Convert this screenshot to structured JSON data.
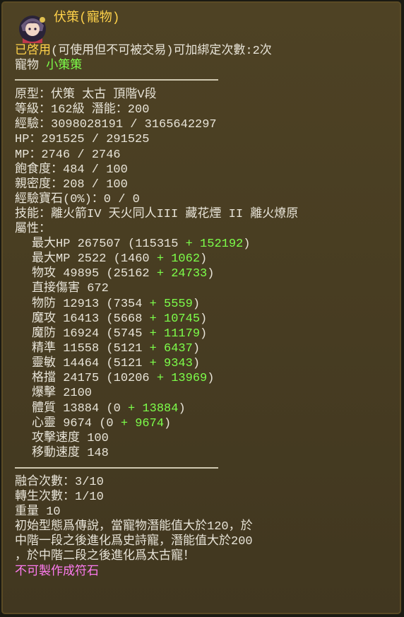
{
  "header": {
    "title": "伏策(寵物)"
  },
  "status": {
    "enabled": "已啓用",
    "rest": "(可使用但不可被交易)可加綁定次數:2次"
  },
  "pet": {
    "label": "寵物 ",
    "name": "小策策"
  },
  "info": {
    "prototype": "原型：伏策 太古 頂階V段",
    "level": "等級：162級 潛能：200",
    "exp": "經驗：3098028191 / 3165642297",
    "hp": "HP：291525 / 291525",
    "mp": "MP：2746 / 2746",
    "satiety": "飽食度：484 / 100",
    "intimacy": "親密度：208 / 100",
    "exp_gem": "經驗寶石(0%)：0 / 0",
    "skills": "技能：離火箭IV 天火同人III 藏花煙 II 離火燎原",
    "attr_title": "屬性："
  },
  "attributes": [
    {
      "base": "最大HP 267507 (115315 ",
      "plus": "+ ",
      "bonus": "152192",
      "close": ")"
    },
    {
      "base": "最大MP 2522 (1460 ",
      "plus": "+ ",
      "bonus": "1062",
      "close": ")"
    },
    {
      "base": "物攻 49895 (25162 ",
      "plus": "+ ",
      "bonus": "24733",
      "close": ")"
    },
    {
      "base": "直接傷害 672",
      "plus": "",
      "bonus": "",
      "close": ""
    },
    {
      "base": "物防 12913 (7354 ",
      "plus": "+ ",
      "bonus": "5559",
      "close": ")"
    },
    {
      "base": "魔攻 16413 (5668 ",
      "plus": "+ ",
      "bonus": "10745",
      "close": ")"
    },
    {
      "base": "魔防 16924 (5745 ",
      "plus": "+ ",
      "bonus": "11179",
      "close": ")"
    },
    {
      "base": "精準 11558 (5121 ",
      "plus": "+ ",
      "bonus": "6437",
      "close": ")"
    },
    {
      "base": "靈敏 14464 (5121 ",
      "plus": "+ ",
      "bonus": "9343",
      "close": ")"
    },
    {
      "base": "格擋 24175 (10206 ",
      "plus": "+ ",
      "bonus": "13969",
      "close": ")"
    },
    {
      "base": "爆擊 2100",
      "plus": "",
      "bonus": "",
      "close": ""
    },
    {
      "base": "體質 13884 (0 ",
      "plus": "+ ",
      "bonus": "13884",
      "close": ")"
    },
    {
      "base": "心靈 9674 (0 ",
      "plus": "+ ",
      "bonus": "9674",
      "close": ")"
    },
    {
      "base": "攻擊速度 100",
      "plus": "",
      "bonus": "",
      "close": ""
    },
    {
      "base": "移動速度 148",
      "plus": "",
      "bonus": "",
      "close": ""
    }
  ],
  "footer": {
    "fusion": "融合次數：3/10",
    "rebirth": "轉生次數：1/10",
    "weight": "重量 10",
    "desc1": "初始型態爲傳說，當寵物潛能值大於120，於",
    "desc2": "中階一段之後進化爲史詩寵，潛能值大於200",
    "desc3": "，於中階二段之後進化爲太古寵！",
    "note": "不可製作成符石"
  },
  "colors": {
    "gold": "#ffd24a",
    "green": "#7dff4a",
    "pink": "#ff7bf0",
    "text": "#e8e4d8"
  }
}
